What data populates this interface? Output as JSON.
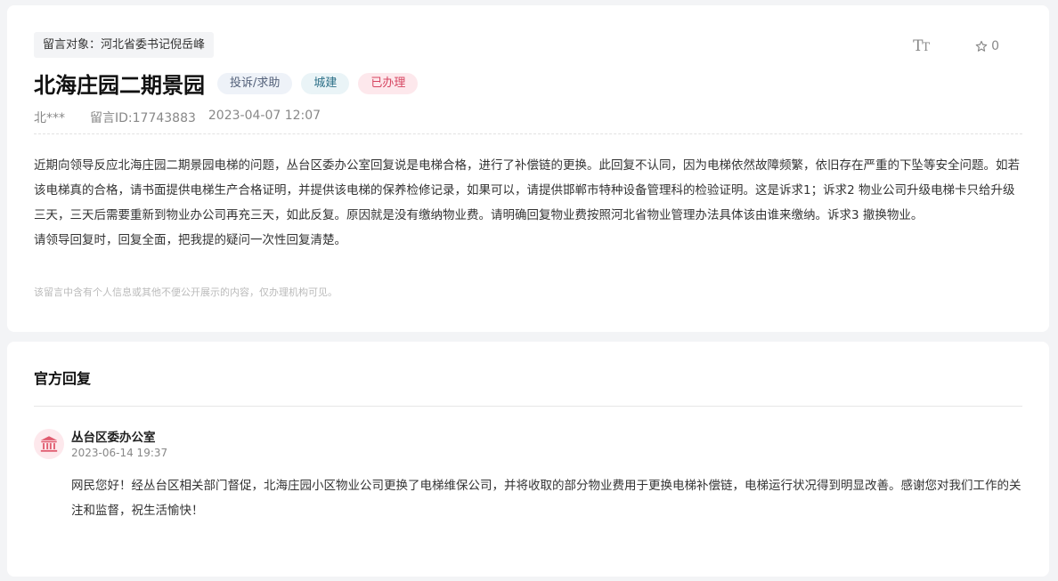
{
  "message": {
    "target": "留言对象：河北省委书记倪岳峰",
    "title": "北海庄园二期景园",
    "tags": [
      "投诉/求助",
      "城建",
      "已办理"
    ],
    "author": "北***",
    "message_id": "留言ID:17743883",
    "datetime": "2023-04-07 12:07",
    "paragraph1": "近期向领导反应北海庄园二期景园电梯的问题，丛台区委办公室回复说是电梯合格，进行了补偿链的更换。此回复不认同，因为电梯依然故障频繁，依旧存在严重的下坠等安全问题。如若该电梯真的合格，请书面提供电梯生产合格证明，并提供该电梯的保养检修记录，如果可以，请提供邯郸市特种设备管理科的检验证明。这是诉求1；诉求2 物业公司升级电梯卡只给升级三天，三天后需要重新到物业办公司再充三天，如此反复。原因就是没有缴纳物业费。请明确回复物业费按照河北省物业管理办法具体该由谁来缴纳。诉求3 撤换物业。",
    "paragraph2": "请领导回复时，回复全面，把我提的疑问一次性回复清楚。",
    "privacy_note": "该留言中含有个人信息或其他不便公开展示的内容，仅办理机构可见。"
  },
  "toolbar": {
    "font_size_icon": "text-size-icon",
    "favorite_icon": "star-outline-icon",
    "favorite_count": "0"
  },
  "reply": {
    "heading": "官方回复",
    "org_icon": "government-building-icon",
    "org_name": "丛台区委办公室",
    "date": "2023-06-14 19:37",
    "body": "网民您好！经丛台区相关部门督促，北海庄园小区物业公司更换了电梯维保公司，并将收取的部分物业费用于更换电梯补偿链，电梯运行状况得到明显改善。感谢您对我们工作的关注和监督，祝生活愉快！"
  },
  "colors": {
    "page_bg": "#f3f4f6",
    "status_tag": "#d64561",
    "category_tag": "#2c6f87",
    "type_tag": "#54617a",
    "org_icon": "#e05a6e"
  }
}
